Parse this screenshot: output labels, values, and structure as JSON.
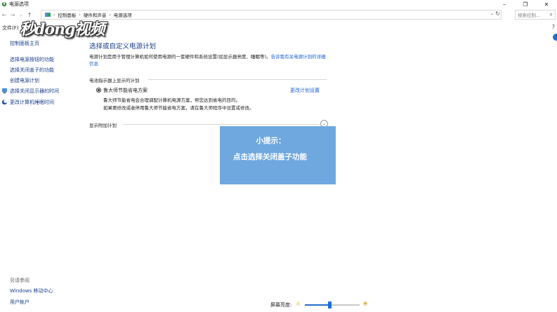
{
  "window": {
    "title": "电源选项",
    "controls": {
      "minimize": "–",
      "restore": "❐",
      "close": "✕"
    }
  },
  "nav": {
    "back": "←",
    "forward": "→",
    "up": "↑"
  },
  "breadcrumb": [
    "控制面板",
    "硬件和声音",
    "电源选项"
  ],
  "breadcrumb_separator": "›",
  "search": {
    "placeholder": "搜索控制..."
  },
  "menu": {
    "file": "文件(F)"
  },
  "watermark": "秒dong视频",
  "sidebar": {
    "items": [
      {
        "label": "控制面板主页"
      },
      {
        "label": "选择电源按钮的功能"
      },
      {
        "label": "选择关闭盖子的功能"
      },
      {
        "label": "创建电源计划"
      },
      {
        "label": "选择关闭显示器的时间"
      },
      {
        "label": "更改计算机睡眠时间"
      }
    ],
    "see_also_title": "另请参阅",
    "see_also": [
      {
        "label": "Windows 移动中心"
      },
      {
        "label": "用户帐户"
      }
    ]
  },
  "main": {
    "title": "选择或自定义电源计划",
    "description": "电源计划是用于管理计算机如何使用电源的一套硬件和系统设置(如显示器亮度、睡眠等)。",
    "description_link": "告诉我有关电源计划的详细信息",
    "section_battery": "电池指示器上显示的计划",
    "plan_name": "鲁大师节能省电方案",
    "plan_settings_link": "更改计划设置",
    "plan_desc_1": "鲁大师节能省电会合理调配计算机电源方案，帮您达到省电的目的。",
    "plan_desc_2": "如果要修改或者停用鲁大师节能省电方案，请在鲁大师程序中设置或修改。",
    "section_additional": "显示附加计划",
    "expand_glyph": "⌄"
  },
  "tooltip": {
    "title": "小提示：",
    "body": "点击选择关闭盖子功能",
    "color": "#6fa8df"
  },
  "brightness": {
    "label": "屏幕亮度:",
    "value_fraction": 0.45
  },
  "colors": {
    "link": "#1a3d8c",
    "accent": "#1f6fd1"
  }
}
